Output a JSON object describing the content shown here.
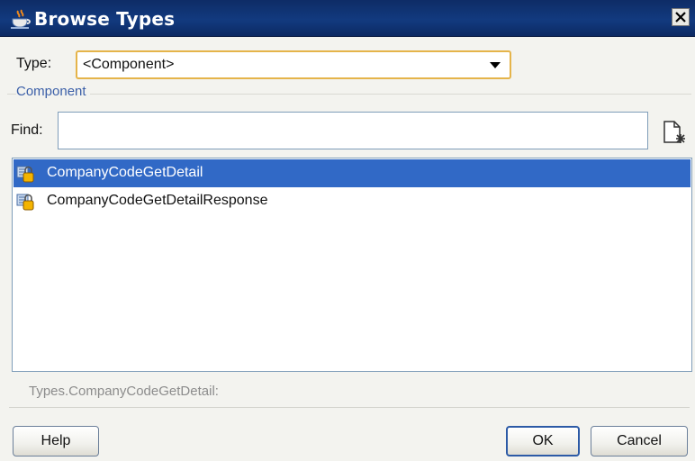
{
  "window": {
    "title": "Browse Types",
    "close_glyph": "✕"
  },
  "type_field": {
    "label": "Type:",
    "selected": "<Component>"
  },
  "group": {
    "label": "Component"
  },
  "find": {
    "label": "Find:",
    "value": ""
  },
  "list": {
    "items": [
      {
        "label": "CompanyCodeGetDetail",
        "selected": true
      },
      {
        "label": "CompanyCodeGetDetailResponse",
        "selected": false
      }
    ]
  },
  "status": {
    "text": "Types.CompanyCodeGetDetail:"
  },
  "buttons": {
    "help": "Help",
    "ok": "OK",
    "cancel": "Cancel"
  },
  "icons": {
    "title": "java-cup-icon",
    "close": "close-icon",
    "find_action": "new-file-icon",
    "list_item": "component-type-icon"
  },
  "colors": {
    "titlebar": "#123a7f",
    "selection": "#3169c6",
    "group_label": "#3b5fa8",
    "select_focus": "#e5b44a"
  }
}
